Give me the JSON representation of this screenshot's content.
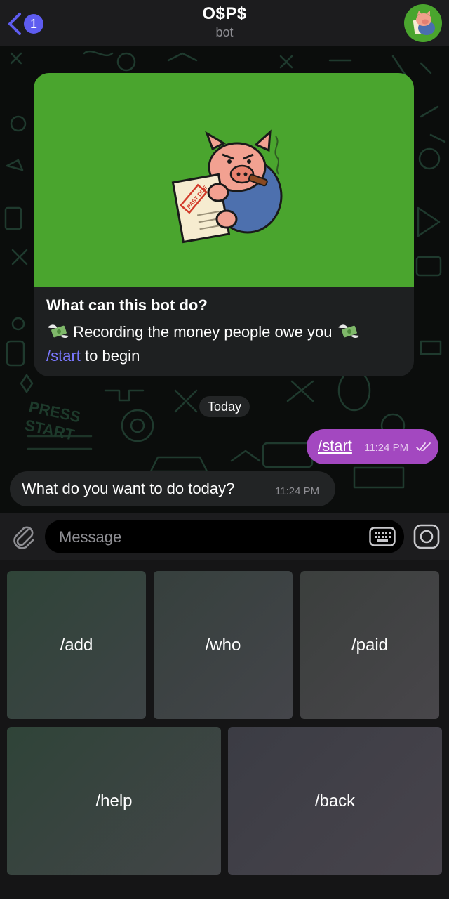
{
  "header": {
    "back_count": "1",
    "title": "O$P$",
    "subtitle": "bot"
  },
  "intro": {
    "heading": "What can this bot do?",
    "description": "Recording the money people owe you",
    "start_command": "/start",
    "start_suffix": " to begin",
    "image_stamp": "PAST DUE",
    "emoji_icon": "money-with-wings-icon"
  },
  "chat": {
    "date_separator": "Today",
    "messages": [
      {
        "direction": "outgoing",
        "text": "/start",
        "time": "11:24 PM",
        "status": "read"
      },
      {
        "direction": "incoming",
        "text": "What do you want to do today?",
        "time": "11:24 PM"
      }
    ]
  },
  "input": {
    "placeholder": "Message"
  },
  "keyboard": {
    "buttons": [
      "/add",
      "/who",
      "/paid",
      "/help",
      "/back"
    ]
  },
  "colors": {
    "accent": "#5e5cf0",
    "outgoing_bubble": "#a348c0",
    "bot_image_bg": "#4aa52e",
    "link": "#7a78ff"
  }
}
